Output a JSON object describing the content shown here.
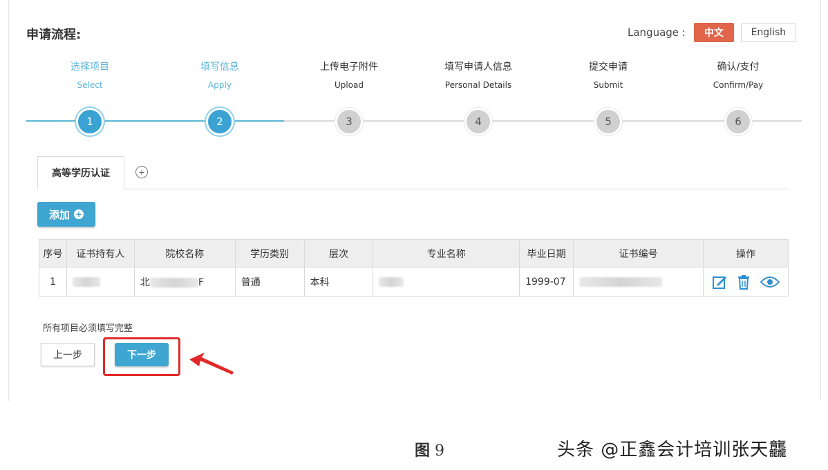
{
  "header": {
    "title": "申请流程:",
    "language_label": "Language :",
    "lang_zh": "中文",
    "lang_en": "English"
  },
  "steps": [
    {
      "cn": "选择项目",
      "en": "Select",
      "num": "1",
      "active": true
    },
    {
      "cn": "填写信息",
      "en": "Apply",
      "num": "2",
      "active": true
    },
    {
      "cn": "上传电子附件",
      "en": "Upload",
      "num": "3",
      "active": false
    },
    {
      "cn": "填写申请人信息",
      "en": "Personal Details",
      "num": "4",
      "active": false
    },
    {
      "cn": "提交申请",
      "en": "Submit",
      "num": "5",
      "active": false
    },
    {
      "cn": "确认/支付",
      "en": "Confirm/Pay",
      "num": "6",
      "active": false
    }
  ],
  "tabs": {
    "active_label": "高等学历认证"
  },
  "toolbar": {
    "add_label": "添加"
  },
  "table": {
    "headers": [
      "序号",
      "证书持有人",
      "院校名称",
      "学历类别",
      "层次",
      "专业名称",
      "毕业日期",
      "证书编号",
      "操作"
    ],
    "row": {
      "index": "1",
      "school_prefix": "北",
      "school_suffix": "F",
      "category": "普通",
      "level": "本科",
      "grad_date": "1999-07"
    }
  },
  "form": {
    "hint": "所有项目必须填写完整",
    "prev_label": "上一步",
    "next_label": "下一步"
  },
  "caption": {
    "fig_label": "图",
    "fig_num": "9"
  },
  "watermark": "头条 @正鑫会计培训张天龘",
  "colors": {
    "accent": "#3fa6d2",
    "lang_active": "#e0654a",
    "highlight": "#e02a2a"
  }
}
